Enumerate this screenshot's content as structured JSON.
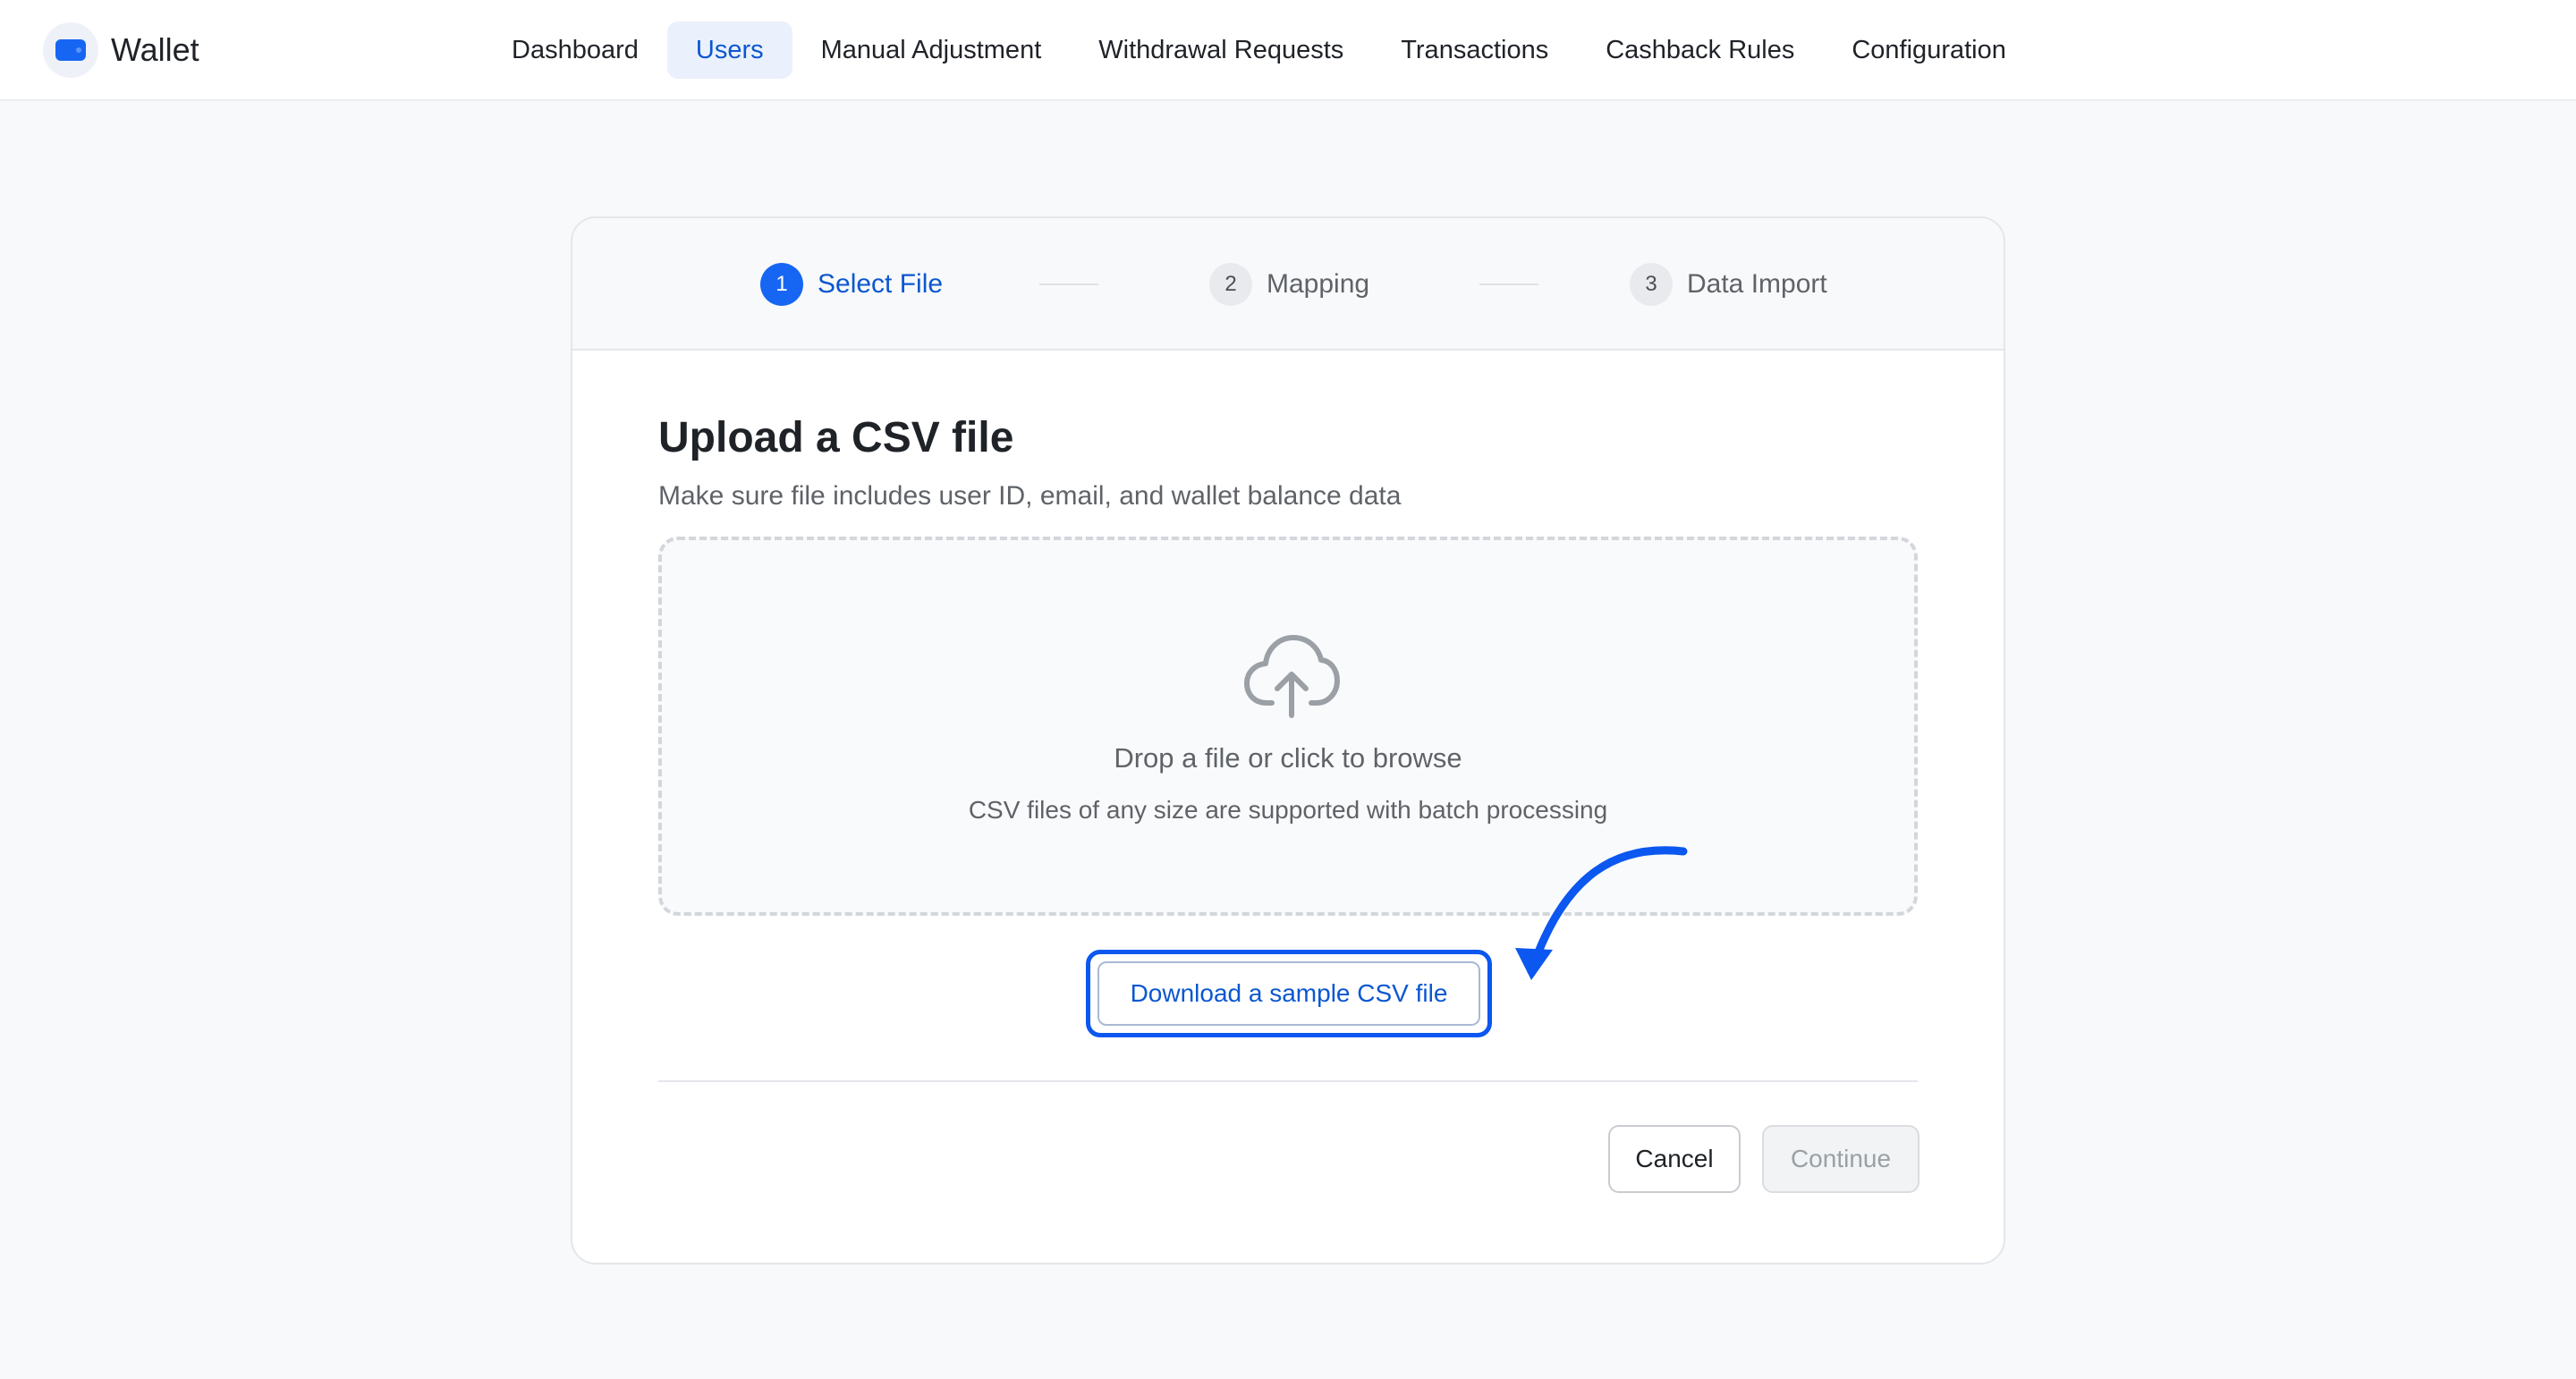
{
  "app": {
    "name": "Wallet"
  },
  "nav": {
    "items": [
      {
        "label": "Dashboard",
        "active": false
      },
      {
        "label": "Users",
        "active": true
      },
      {
        "label": "Manual Adjustment",
        "active": false
      },
      {
        "label": "Withdrawal Requests",
        "active": false
      },
      {
        "label": "Transactions",
        "active": false
      },
      {
        "label": "Cashback Rules",
        "active": false
      },
      {
        "label": "Configuration",
        "active": false
      }
    ]
  },
  "steps": [
    {
      "number": "1",
      "label": "Select File",
      "active": true
    },
    {
      "number": "2",
      "label": "Mapping",
      "active": false
    },
    {
      "number": "3",
      "label": "Data Import",
      "active": false
    }
  ],
  "upload": {
    "title": "Upload a CSV file",
    "subtitle": "Make sure file includes user ID, email, and wallet balance data",
    "icon": "cloud-upload-icon",
    "drop_title": "Drop a file or click to browse",
    "drop_sub": "CSV files of any size are supported with batch processing",
    "sample_label": "Download a sample CSV file"
  },
  "actions": {
    "cancel_label": "Cancel",
    "continue_label": "Continue",
    "continue_disabled": true
  },
  "colors": {
    "accent": "#1766f3",
    "link": "#0b57d0",
    "annotation": "#0b57f0"
  }
}
